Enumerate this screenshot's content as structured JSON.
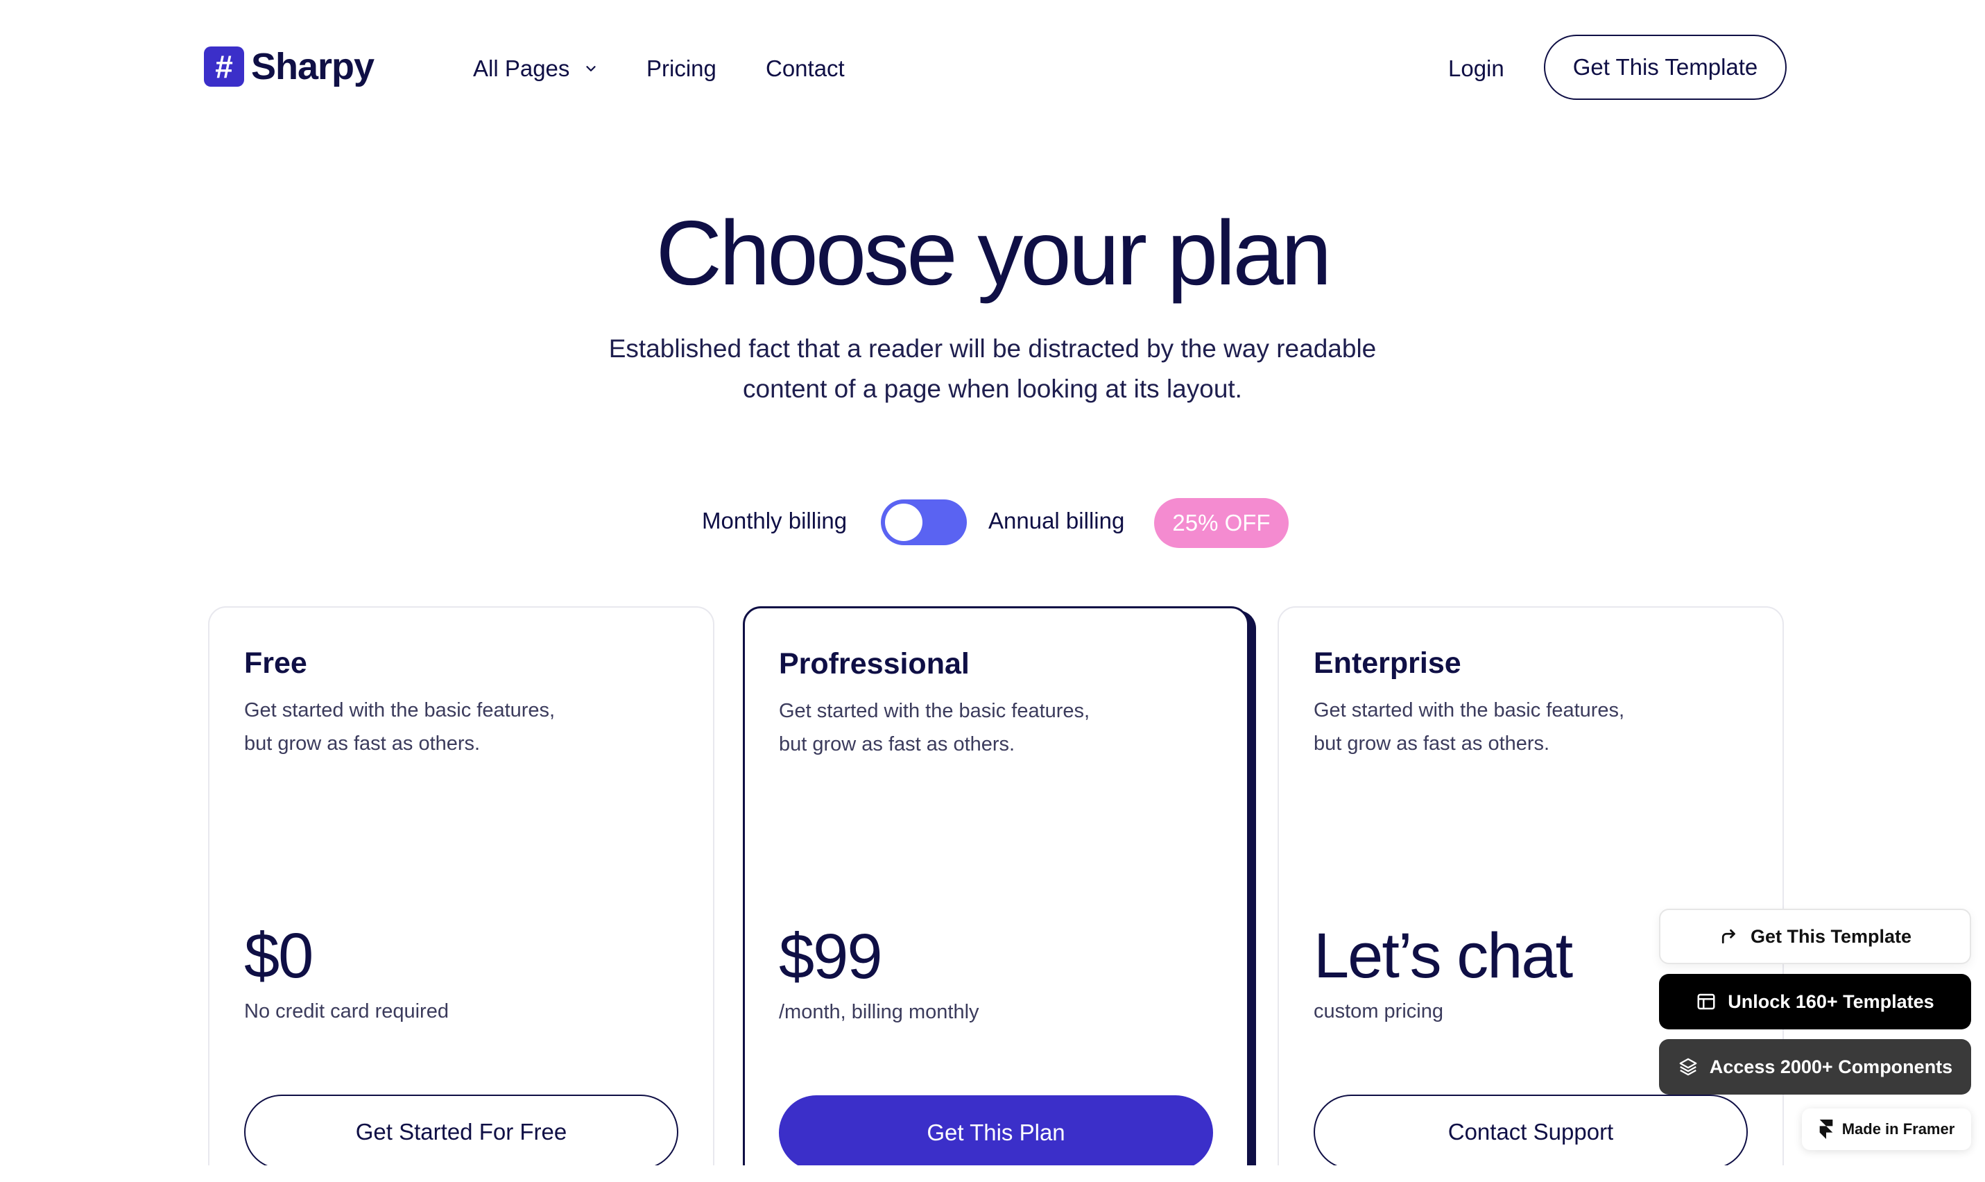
{
  "brand": {
    "mark": "#",
    "name": "Sharpy",
    "color": "#3b2fc9"
  },
  "nav": {
    "all_pages": "All Pages",
    "pricing": "Pricing",
    "contact": "Contact",
    "login": "Login",
    "cta": "Get This Template"
  },
  "hero": {
    "title": "Choose your plan",
    "subtitle_line1": "Established fact that a reader will be distracted by the way readable",
    "subtitle_line2": "content of a page when looking at its layout."
  },
  "billing": {
    "monthly_label": "Monthly billing",
    "annual_label": "Annual billing",
    "discount_badge": "25% OFF",
    "toggle_on": true,
    "toggle_color": "#5a63f2",
    "badge_color": "#f48bd0"
  },
  "plans": [
    {
      "title": "Free",
      "desc_line1": "Get started with the basic features,",
      "desc_line2": "but grow as fast as others.",
      "price": "$0",
      "note": "No credit card required",
      "button": "Get Started For Free"
    },
    {
      "title": "Profressional",
      "desc_line1": "Get started with the basic features,",
      "desc_line2": "but grow as fast as others.",
      "price": "$99",
      "note": "/month, billing monthly",
      "button": "Get This Plan",
      "highlighted": true
    },
    {
      "title": "Enterprise",
      "desc_line1": "Get started with the basic features,",
      "desc_line2": "but grow as fast as others.",
      "price": "Let’s chat",
      "note": "custom pricing",
      "button": "Contact Support"
    }
  ],
  "framer_widgets": {
    "get_template": "Get This Template",
    "unlock": "Unlock 160+ Templates",
    "access": "Access 2000+ Components",
    "made_in": "Made in Framer"
  }
}
